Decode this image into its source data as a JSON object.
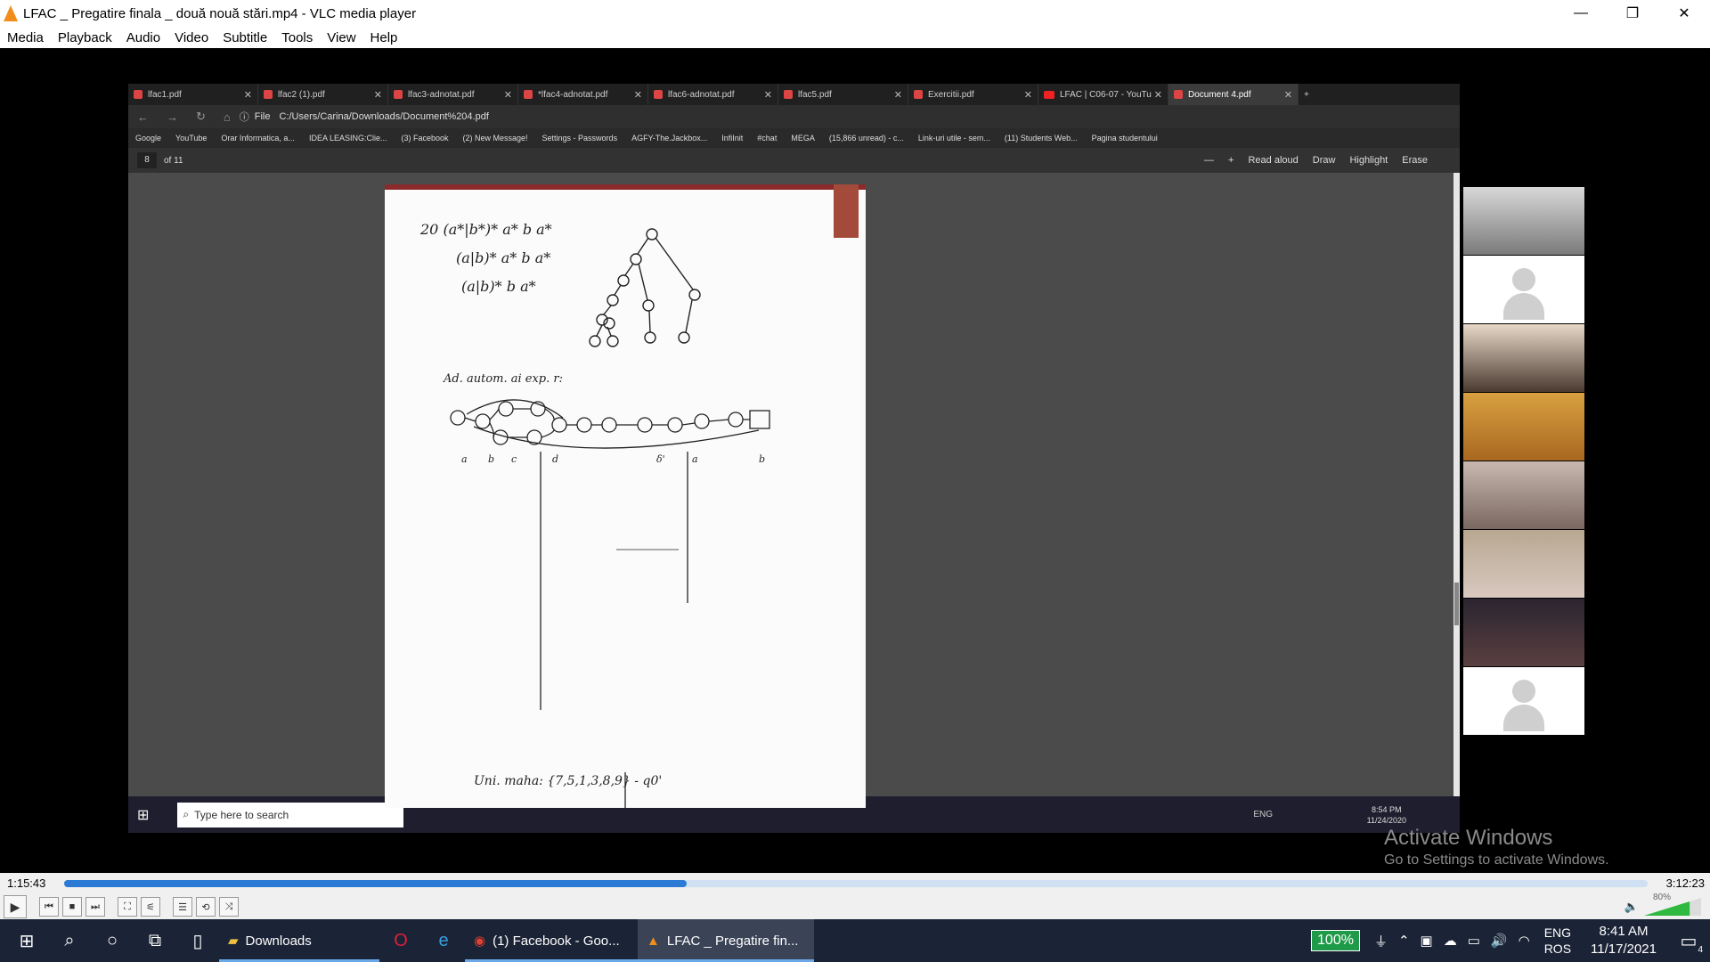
{
  "window": {
    "title": "LFAC _ Pregatire finala _ două nouă stări.mp4 - VLC media player",
    "minimize": "—",
    "restore": "❐",
    "close": "✕"
  },
  "menu": [
    "Media",
    "Playback",
    "Audio",
    "Video",
    "Subtitle",
    "Tools",
    "View",
    "Help"
  ],
  "browser": {
    "tabs": [
      {
        "label": "lfac1.pdf",
        "type": "pdf"
      },
      {
        "label": "lfac2 (1).pdf",
        "type": "pdf"
      },
      {
        "label": "lfac3-adnotat.pdf",
        "type": "pdf"
      },
      {
        "label": "*lfac4-adnotat.pdf",
        "type": "pdf"
      },
      {
        "label": "lfac6-adnotat.pdf",
        "type": "pdf"
      },
      {
        "label": "lfac5.pdf",
        "type": "pdf"
      },
      {
        "label": "Exercitii.pdf",
        "type": "pdf"
      },
      {
        "label": "LFAC | C06-07 - YouTu",
        "type": "youtube"
      },
      {
        "label": "Document 4.pdf",
        "type": "pdf",
        "active": true
      }
    ],
    "address_prefix": "File",
    "url": "C:/Users/Carina/Downloads/Document%204.pdf",
    "bookmarks": [
      "Google",
      "YouTube",
      "Orar Informatica, a...",
      "IDEA LEASING:Clie...",
      "(3) Facebook",
      "(2) New Message!",
      "Settings - Passwords",
      "AGFY-The.Jackbox...",
      "InfiInit",
      "#chat",
      "MEGA",
      "(15,866 unread) - c...",
      "Link-uri utile - sem...",
      "(11) Students Web...",
      "Pagina studentului"
    ],
    "pdf": {
      "page": "8",
      "of": "of 11",
      "tools": [
        "—",
        "+",
        "Read aloud",
        "Draw",
        "Highlight",
        "Erase"
      ]
    },
    "notes": {
      "ex_line1": "20 (a*|b*)* a* b a*",
      "ex_line2": "(a|b)* a* b a*",
      "ex_line3": "(a|b)* b a*",
      "ad_text": "Ad. autom. ai exp. r:",
      "final_text": "Uni. maha: {7,5,1,3,8,9} - q0'"
    },
    "inner_taskbar": {
      "search_placeholder": "Type here to search",
      "time": "8:54 PM",
      "date": "11/24/2020",
      "lang": "ENG"
    }
  },
  "watermark": {
    "title": "Activate Windows",
    "subtitle": "Go to Settings to activate Windows."
  },
  "player": {
    "elapsed": "1:15:43",
    "total": "3:12:23",
    "progress_fraction": 0.393,
    "volume": "80%",
    "volume_fraction": 0.8
  },
  "taskbar": {
    "apps": [
      {
        "label": "Downloads",
        "active": false
      },
      {
        "label": "(1) Facebook - Goo...",
        "active": false
      },
      {
        "label": "LFAC _ Pregatire fin...",
        "active": true
      }
    ],
    "battery": "100%",
    "lang_top": "ENG",
    "lang_bottom": "ROS",
    "time": "8:41 AM",
    "date": "11/17/2021",
    "notifications": "4"
  },
  "colors": {
    "vlc_orange": "#f28c1a",
    "seek_blue": "#2a7ad6",
    "volume_green": "#2fba3f",
    "battery_green": "#1f9a48"
  }
}
